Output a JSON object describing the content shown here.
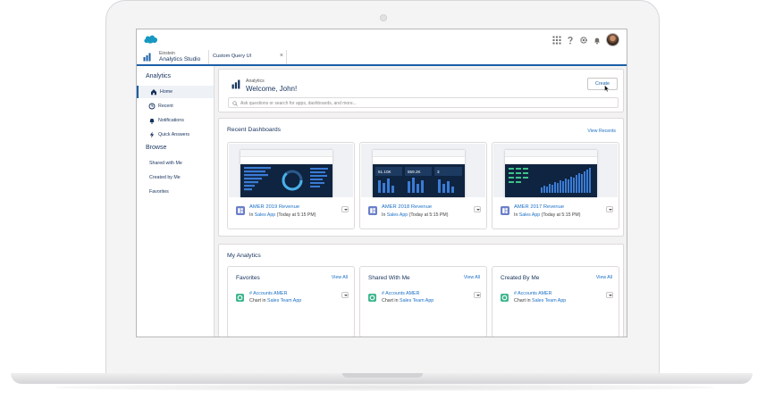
{
  "window": {
    "title": "Analytics Studio",
    "app_sublabel": "Einstein"
  },
  "tabs": [
    {
      "label": "Custom Query UI",
      "close": "×"
    }
  ],
  "sidebar": {
    "section1": "Analytics",
    "items": [
      {
        "label": "Home",
        "icon": "home-icon",
        "active": true
      },
      {
        "label": "Recent",
        "icon": "clock-icon"
      },
      {
        "label": "Notifications",
        "icon": "bell-icon"
      },
      {
        "label": "Quick Answers",
        "icon": "bolt-icon"
      }
    ],
    "section2": "Browse",
    "browse": [
      {
        "label": "Shared with Me"
      },
      {
        "label": "Created by Me"
      },
      {
        "label": "Favorites"
      }
    ]
  },
  "welcome": {
    "small": "Analytics",
    "title": "Welcome, John!",
    "create": "Create",
    "search_placeholder": "Ask questions or search for apps, dashboards, and more..."
  },
  "recent": {
    "title": "Recent Dashboards",
    "view_link": "View Recents",
    "cards": [
      {
        "title": "AMER 2019 Revenue",
        "in": "In",
        "app": "Sales App",
        "time": "(Today at 5:15 PM)"
      },
      {
        "title": "AMER 2018 Revenue",
        "in": "In",
        "app": "Sales App",
        "time": "(Today at 5:15 PM)",
        "kpis": [
          "51.10K",
          "559.2K",
          "3"
        ]
      },
      {
        "title": "AMER 2017 Revenue",
        "in": "In",
        "app": "Sales App",
        "time": "(Today at 5:15 PM)"
      }
    ]
  },
  "my_analytics": {
    "title": "My Analytics",
    "cards": [
      {
        "title": "Favorites",
        "view": "View All",
        "item": "# Accounts AMER",
        "chart": "Chart in",
        "app": "Sales Team App"
      },
      {
        "title": "Shared With Me",
        "view": "View All",
        "item": "# Accounts AMER",
        "chart": "Chart in",
        "app": "Sales Team App"
      },
      {
        "title": "Created By Me",
        "view": "View All",
        "item": "# Accounts AMER",
        "chart": "Chart in",
        "app": "Sales Team App"
      }
    ]
  },
  "colors": {
    "brand": "#1b5fa6",
    "link": "#1b70c6",
    "dashboard_bg": "#0f2440",
    "chart_icon": "#3fb68e",
    "dashboard_icon": "#6b7fc9"
  }
}
